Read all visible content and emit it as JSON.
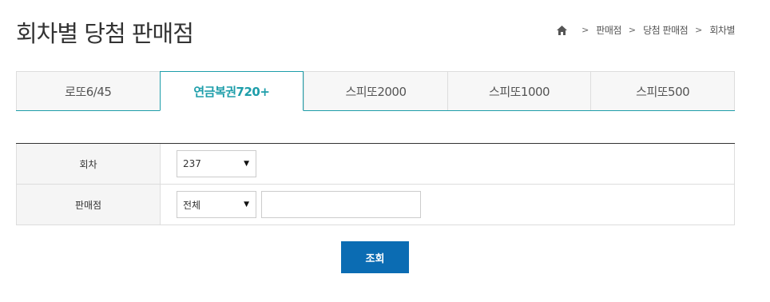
{
  "page": {
    "title": "회차별 당첨 판매점"
  },
  "breadcrumb": {
    "home_icon": "home-icon",
    "separator": ">",
    "items": [
      "판매점",
      "당첨 판매점",
      "회차별"
    ]
  },
  "tabs": [
    {
      "label": "로또6/45",
      "active": false
    },
    {
      "label": "연금복권720+",
      "active": true
    },
    {
      "label": "스피또2000",
      "active": false
    },
    {
      "label": "스피또1000",
      "active": false
    },
    {
      "label": "스피또500",
      "active": false
    }
  ],
  "form": {
    "round": {
      "label": "회차",
      "selected": "237",
      "caret": "▼"
    },
    "store": {
      "label": "판매점",
      "selected": "전체",
      "caret": "▼",
      "input_value": "",
      "input_placeholder": ""
    }
  },
  "actions": {
    "search_label": "조회"
  },
  "colors": {
    "accent": "#1e9eaa",
    "button": "#0b6cb3",
    "label_bg": "#f5f5f5",
    "border": "#dddddd"
  }
}
